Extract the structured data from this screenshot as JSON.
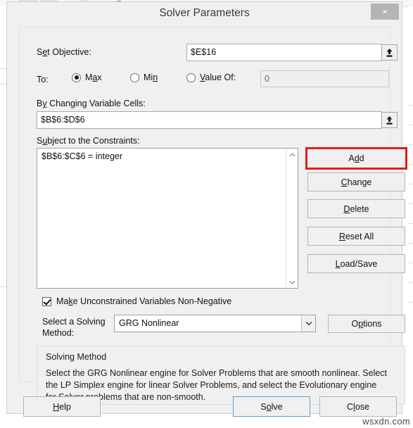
{
  "window": {
    "title": "Solver Parameters",
    "close_label": "×"
  },
  "objective": {
    "label": "Set Objective:",
    "label_prefix": "Set",
    "label_underlined": "O",
    "value": "$E$16",
    "picker_icon": "range-picker-icon"
  },
  "goal": {
    "label": "To:",
    "options": [
      {
        "label": "Max",
        "selected": true
      },
      {
        "label": "Min",
        "selected": false
      },
      {
        "label": "Value Of:",
        "selected": false
      }
    ],
    "value_of_field": {
      "value": "0",
      "enabled": false
    }
  },
  "variables": {
    "label": "By Changing Variable Cells:",
    "value": "$B$6:$D$6",
    "picker_icon": "range-picker-icon"
  },
  "constraints": {
    "label": "Subject to the Constraints:",
    "items": [
      "$B$6:$C$6 = integer"
    ],
    "scrollbar": {
      "up_icon": "chevron-up-icon",
      "down_icon": "chevron-down-icon"
    },
    "buttons": [
      {
        "name": "add",
        "label": "Add",
        "highlighted": true
      },
      {
        "name": "change",
        "label": "Change",
        "highlighted": false
      },
      {
        "name": "delete",
        "label": "Delete",
        "highlighted": false
      },
      {
        "name": "reset-all",
        "label": "Reset All",
        "highlighted": false
      },
      {
        "name": "load-save",
        "label": "Load/Save",
        "highlighted": false
      }
    ]
  },
  "non_negative": {
    "label": "Make Unconstrained Variables Non-Negative",
    "checked": true
  },
  "solving_method": {
    "label_line1": "Select a Solving",
    "label_line2": "Method:",
    "selected": "GRG Nonlinear",
    "dropdown_icon": "chevron-down-icon",
    "options_button": "Options"
  },
  "info": {
    "title": "Solving Method",
    "text": "Select the GRG Nonlinear engine for Solver Problems that are smooth nonlinear. Select the LP Simplex engine for linear Solver Problems, and select the Evolutionary engine for Solver problems that are non-smooth."
  },
  "footer": {
    "help": "Help",
    "solve": "Solve",
    "close": "Close"
  },
  "watermark": "wsxdn.com",
  "colors": {
    "highlight_red": "#e51b12",
    "focus_blue": "#56a0d8",
    "dialog_bg": "#f0f0f0",
    "titlebar_close": "#b4b4b4"
  }
}
